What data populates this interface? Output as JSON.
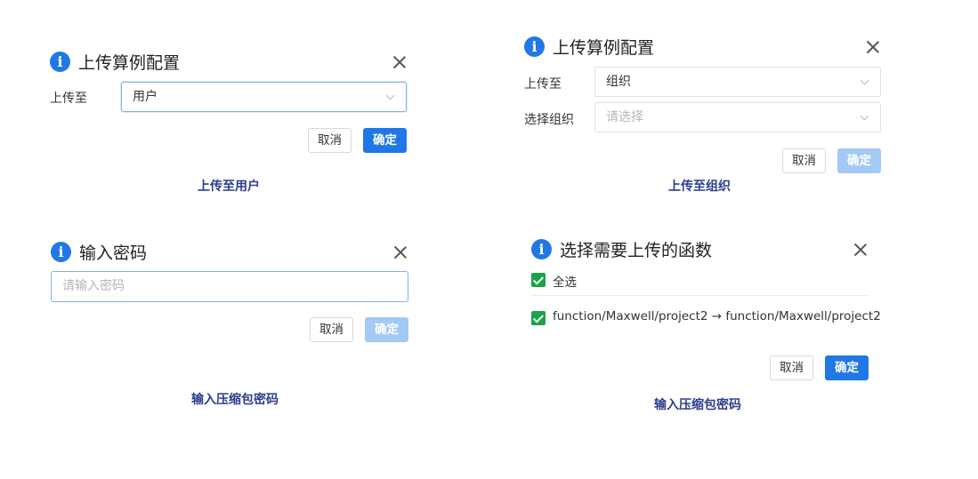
{
  "dialog_user": {
    "title": "上传算例配置",
    "upload_to_label": "上传至",
    "upload_to_value": "用户",
    "cancel_label": "取消",
    "ok_label": "确定",
    "caption": "上传至用户"
  },
  "dialog_org": {
    "title": "上传算例配置",
    "upload_to_label": "上传至",
    "upload_to_value": "组织",
    "select_org_label": "选择组织",
    "select_org_placeholder": "请选择",
    "cancel_label": "取消",
    "ok_label": "确定",
    "caption": "上传至组织"
  },
  "dialog_password": {
    "title": "输入密码",
    "password_placeholder": "请输入密码",
    "cancel_label": "取消",
    "ok_label": "确定",
    "caption": "输入压缩包密码"
  },
  "dialog_functions": {
    "title": "选择需要上传的函数",
    "select_all_label": "全选",
    "items": [
      {
        "label": "function/Maxwell/project2 → function/Maxwell/project2",
        "checked": true
      }
    ],
    "cancel_label": "取消",
    "ok_label": "确定",
    "caption": "输入压缩包密码"
  },
  "colors": {
    "primary": "#1f78e6",
    "primary_disabled": "#a3c9f5",
    "checkbox_green": "#1aa34a",
    "caption_navy": "#2c3c8c"
  },
  "icons": {
    "info": "info-icon",
    "close": "close-icon",
    "dropdown": "chevron-down-icon",
    "check": "check-icon"
  }
}
